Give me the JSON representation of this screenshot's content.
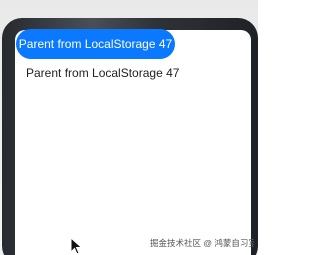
{
  "button": {
    "label": "Parent from LocalStorage 47"
  },
  "content": {
    "text": "Parent from LocalStorage 47"
  },
  "watermark": {
    "text": "掘金技术社区 @ 鸿蒙自习室"
  },
  "colors": {
    "accent": "#0a78ff",
    "screen_bg": "#ffffff",
    "text": "#222222",
    "frame": "#2f3338"
  },
  "icons": {
    "pointer": "mouse-pointer-icon"
  }
}
